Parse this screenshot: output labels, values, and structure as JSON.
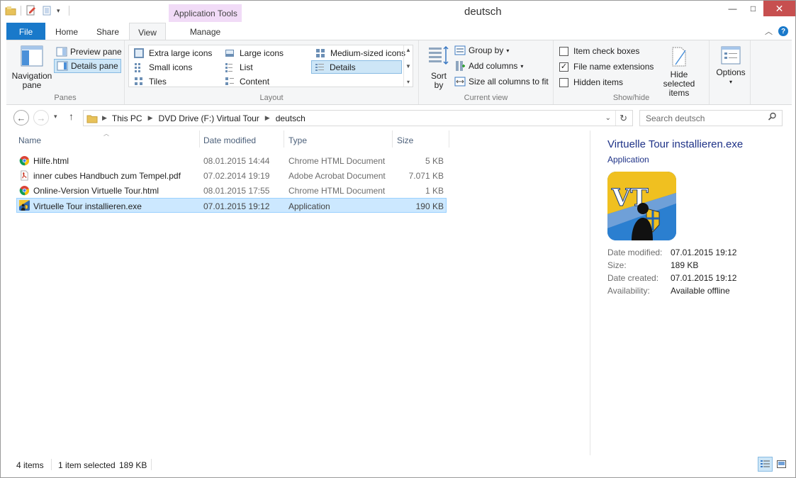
{
  "window": {
    "title": "deutsch",
    "context_tab_group": "Application Tools",
    "buttons": {
      "minimize": "—",
      "maximize": "□",
      "close": "✕"
    }
  },
  "ribbon_tabs": {
    "file": "File",
    "home": "Home",
    "share": "Share",
    "view": "View",
    "manage": "Manage",
    "active": "View"
  },
  "ribbon": {
    "panes": {
      "label": "Panes",
      "navigation_pane": "Navigation pane",
      "preview_pane": "Preview pane",
      "details_pane": "Details pane"
    },
    "layout": {
      "label": "Layout",
      "items": [
        "Extra large icons",
        "Large icons",
        "Medium-sized icons",
        "Small icons",
        "List",
        "Details",
        "Tiles",
        "Content"
      ],
      "selected": "Details"
    },
    "current_view": {
      "label": "Current view",
      "sort_by": "Sort by",
      "group_by": "Group by",
      "add_columns": "Add columns",
      "size_all_columns": "Size all columns to fit"
    },
    "show_hide": {
      "label": "Show/hide",
      "item_check_boxes": {
        "label": "Item check boxes",
        "checked": false
      },
      "file_name_extensions": {
        "label": "File name extensions",
        "checked": true
      },
      "hidden_items": {
        "label": "Hidden items",
        "checked": false
      },
      "hide_selected_items": "Hide selected items"
    },
    "options": "Options"
  },
  "address": {
    "crumbs": [
      "This PC",
      "DVD Drive (F:) Virtual Tour",
      "deutsch"
    ],
    "search_placeholder": "Search deutsch"
  },
  "columns": {
    "name": "Name",
    "date_modified": "Date modified",
    "type": "Type",
    "size": "Size"
  },
  "files": [
    {
      "name": "Hilfe.html",
      "date": "08.01.2015 14:44",
      "type": "Chrome HTML Document",
      "size": "5 KB",
      "icon": "chrome-icon",
      "selected": false
    },
    {
      "name": "inner cubes Handbuch zum Tempel.pdf",
      "date": "07.02.2014 19:19",
      "type": "Adobe Acrobat Document",
      "size": "7.071 KB",
      "icon": "pdf-icon",
      "selected": false
    },
    {
      "name": "Online-Version Virtuelle Tour.html",
      "date": "08.01.2015 17:55",
      "type": "Chrome HTML Document",
      "size": "1 KB",
      "icon": "chrome-icon",
      "selected": false
    },
    {
      "name": "Virtuelle Tour installieren.exe",
      "date": "07.01.2015 19:12",
      "type": "Application",
      "size": "190 KB",
      "icon": "app-icon",
      "selected": true
    }
  ],
  "details": {
    "title": "Virtuelle Tour installieren.exe",
    "type": "Application",
    "thumb_text": "VT",
    "props": [
      {
        "label": "Date modified:",
        "value": "07.01.2015 19:12"
      },
      {
        "label": "Size:",
        "value": "189 KB"
      },
      {
        "label": "Date created:",
        "value": "07.01.2015 19:12"
      },
      {
        "label": "Availability:",
        "value": "Available offline"
      }
    ]
  },
  "status": {
    "item_count": "4 items",
    "selection": "1 item selected",
    "selection_size": "189 KB"
  },
  "colors": {
    "accent": "#1979ca",
    "selection": "#cce8ff",
    "context_tab": "#f1dbf7",
    "close": "#c74f4f"
  }
}
